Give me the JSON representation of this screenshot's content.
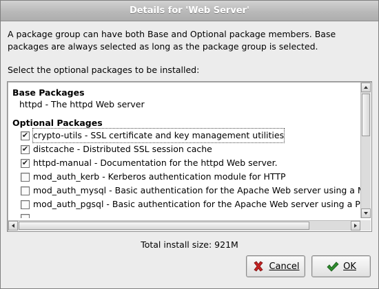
{
  "window": {
    "title": "Details for 'Web Server'"
  },
  "intro": "A package group can have both Base and Optional package members.  Base packages are always selected as long as the package group is selected.",
  "select_label": "Select the optional packages to be installed:",
  "base": {
    "heading": "Base Packages",
    "items": [
      "httpd - The httpd Web server"
    ]
  },
  "optional": {
    "heading": "Optional Packages",
    "items": [
      {
        "text": "crypto-utils - SSL certificate and key management utilities",
        "checked": true
      },
      {
        "text": "distcache - Distributed SSL session cache",
        "checked": true
      },
      {
        "text": "httpd-manual - Documentation for the httpd Web server.",
        "checked": true
      },
      {
        "text": "mod_auth_kerb - Kerberos authentication module for HTTP",
        "checked": false
      },
      {
        "text": "mod_auth_mysql - Basic authentication for the Apache Web server using a MySQL database",
        "checked": false
      },
      {
        "text": "mod_auth_pgsql - Basic authentication for the Apache Web server using a PostgreSQL database",
        "checked": false
      },
      {
        "text": "",
        "checked": false
      }
    ]
  },
  "total": "Total install size: 921M",
  "buttons": {
    "cancel": {
      "label": "Cancel",
      "icon": "red-x-icon"
    },
    "ok": {
      "label": "OK",
      "icon": "green-check-icon"
    }
  },
  "colors": {
    "cancel_icon": "#c42222",
    "ok_icon": "#2e8b2e",
    "titlebar_text": "#ffffff"
  }
}
